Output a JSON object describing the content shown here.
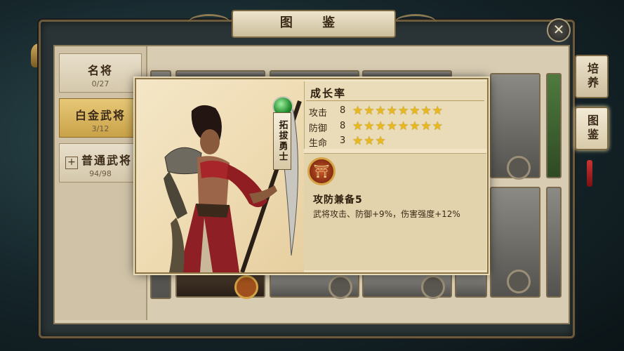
{
  "title": "图 鉴",
  "sidebar": {
    "items": [
      {
        "label": "名将",
        "count": "0/27"
      },
      {
        "label": "白金武将",
        "count": "3/12"
      },
      {
        "label": "普通武将",
        "count": "94/98"
      }
    ]
  },
  "right_tabs": [
    {
      "label": "培养"
    },
    {
      "label": "图鉴"
    }
  ],
  "hero": {
    "name": "拓拔勇士"
  },
  "stats": {
    "title": "成长率",
    "rows": [
      {
        "label": "攻击",
        "value": "8",
        "stars": "★★★★★★★★"
      },
      {
        "label": "防御",
        "value": "8",
        "stars": "★★★★★★★★"
      },
      {
        "label": "生命",
        "value": "3",
        "stars": "★★★"
      }
    ]
  },
  "skill": {
    "name": "攻防兼备5",
    "description": "武将攻击、防御+9%，伤害强度+12%"
  },
  "icons": {
    "close": "close-icon",
    "add": "plus-icon",
    "skill": "skill-emblem-icon"
  }
}
